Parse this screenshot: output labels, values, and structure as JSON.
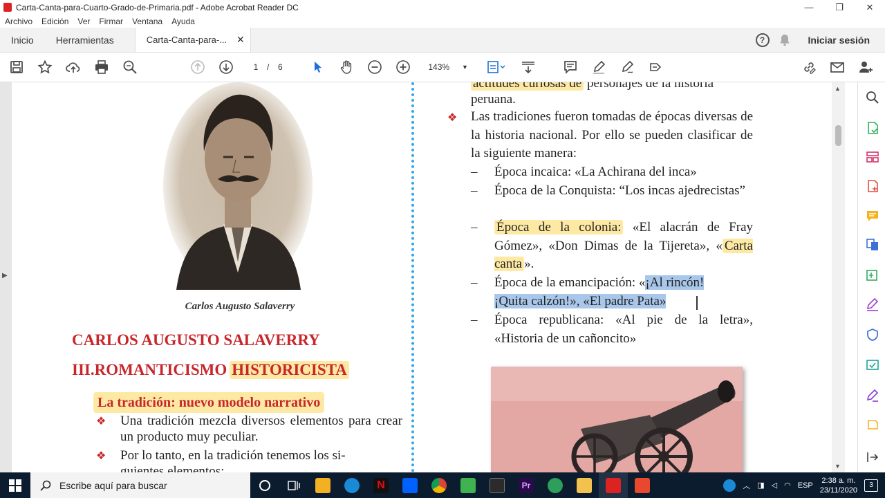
{
  "window": {
    "title": "Carta-Canta-para-Cuarto-Grado-de-Primaria.pdf - Adobe Acrobat Reader DC",
    "minimize": "—",
    "maximize": "❐",
    "close": "✕"
  },
  "menu": [
    "Archivo",
    "Edición",
    "Ver",
    "Firmar",
    "Ventana",
    "Ayuda"
  ],
  "tabs": {
    "home": "Inicio",
    "tools": "Herramientas",
    "document": "Carta-Canta-para-...",
    "close": "✕",
    "help": "?",
    "signin": "Iniciar sesión"
  },
  "toolbar": {
    "page_current": "1",
    "page_separator": "/",
    "page_total": "6",
    "zoom": "143%"
  },
  "document": {
    "left": {
      "caption": "Carlos Augusto Salaverry",
      "heading1": "CARLOS AUGUSTO SALAVERRY",
      "heading2_prefix": "III.ROMANTICISMO",
      "heading2_highlight": "HISTORICISTA",
      "subtitle": "La tradición: nuevo modelo narrativo",
      "bullet_symbol": "❖",
      "bullet1": "Una tradición mezcla diversos elementos para crear un producto muy peculiar.",
      "bullet2": "Por lo tanto, en la tradición tenemos los si-",
      "bullet2_cut": "guientes elementos:"
    },
    "right": {
      "line_top_highlight": "actitudes curiosas de",
      "line_top_rest": " personajes de la historia",
      "line_peruana": "peruana.",
      "bullet_symbol": "❖",
      "intro": "Las tradiciones fueron tomadas de épocas diversas de la historia nacional. Por ello se pueden clasificar de la siguiente manera:",
      "dash": "–",
      "item1": "Época incaica: «La Achirana del inca»",
      "item2": "Época de la Conquista: “Los incas ajedrecistas”",
      "item3_highlight": "Época de la colonia:",
      "item3_rest": " «El alacrán de Fray Gómez», «Don Dimas de la Tijereta», «",
      "item3_highlight2": "Carta canta",
      "item3_end": "».",
      "item4_prefix": "Época de la emancipación: «",
      "item4_sel1": "¡Al rincón!",
      "item4_sel2": "¡Quita calzón!», «El padre Pata»",
      "item5": "Época republicana: «Al pie de  la letra», «Historia de un cañoncito»"
    }
  },
  "taskbar": {
    "search_placeholder": "Escribe aquí para buscar",
    "lang": "ESP",
    "time": "2:38 a. m.",
    "date": "23/11/2020",
    "notifications": "3"
  },
  "colors": {
    "heading_red": "#c8262b",
    "highlight_yellow": "#fde9a3",
    "selection_blue": "#a9c7ea",
    "page_divider_blue": "#2ea8e6",
    "taskbar": "#0b1c2e"
  }
}
